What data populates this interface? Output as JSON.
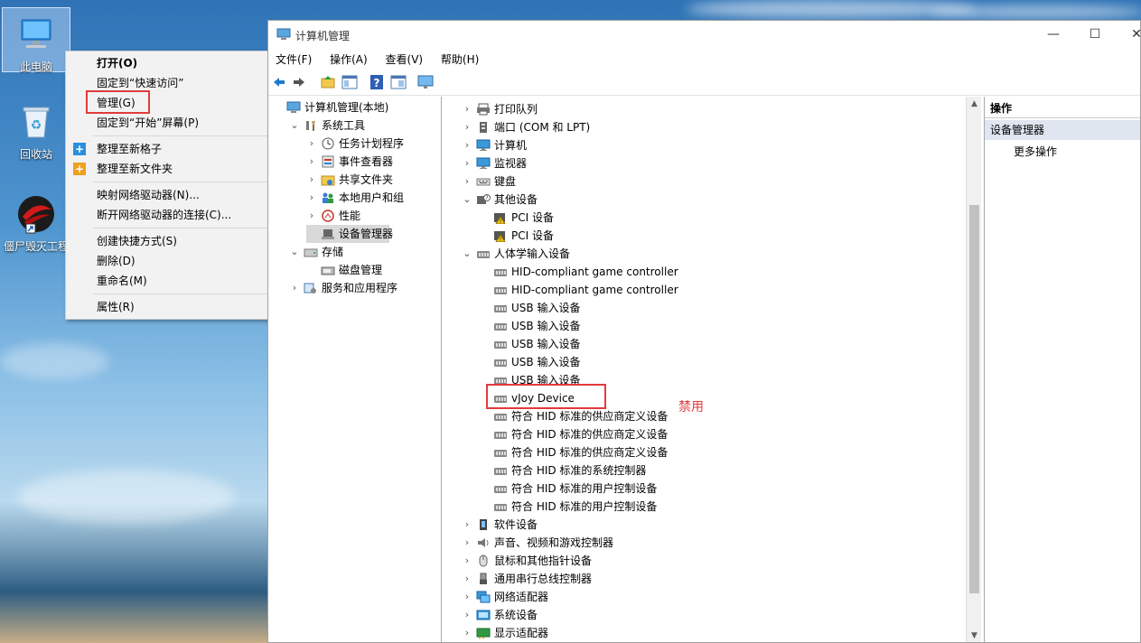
{
  "desktop": {
    "icons": [
      {
        "label": "此电脑"
      },
      {
        "label": "回收站"
      },
      {
        "label": "僵尸毁灭工程"
      }
    ]
  },
  "context_menu": {
    "items": [
      {
        "label": "打开(O)",
        "bold": true
      },
      {
        "label": "固定到“快速访问”"
      },
      {
        "label": "管理(G)",
        "highlighted": true
      },
      {
        "label": "固定到“开始”屏幕(P)"
      },
      {
        "separator": true
      },
      {
        "label": "整理至新格子",
        "icon": "plus-blue-icon"
      },
      {
        "label": "整理至新文件夹",
        "icon": "plus-orange-icon"
      },
      {
        "separator": true
      },
      {
        "label": "映射网络驱动器(N)..."
      },
      {
        "label": "断开网络驱动器的连接(C)..."
      },
      {
        "separator": true
      },
      {
        "label": "创建快捷方式(S)"
      },
      {
        "label": "删除(D)"
      },
      {
        "label": "重命名(M)"
      },
      {
        "separator": true
      },
      {
        "label": "属性(R)"
      }
    ]
  },
  "window": {
    "title": "计算机管理",
    "menus": [
      "文件(F)",
      "操作(A)",
      "查看(V)",
      "帮助(H)"
    ],
    "left_tree": [
      {
        "label": "计算机管理(本地)",
        "indent": 0,
        "exp": "",
        "icon": "computer-manage-icon"
      },
      {
        "label": "系统工具",
        "indent": 1,
        "exp": "v",
        "icon": "tools-icon"
      },
      {
        "label": "任务计划程序",
        "indent": 2,
        "exp": ">",
        "icon": "clock-icon"
      },
      {
        "label": "事件查看器",
        "indent": 2,
        "exp": ">",
        "icon": "event-viewer-icon"
      },
      {
        "label": "共享文件夹",
        "indent": 2,
        "exp": ">",
        "icon": "shared-folder-icon"
      },
      {
        "label": "本地用户和组",
        "indent": 2,
        "exp": ">",
        "icon": "users-icon"
      },
      {
        "label": "性能",
        "indent": 2,
        "exp": ">",
        "icon": "performance-icon"
      },
      {
        "label": "设备管理器",
        "indent": 2,
        "exp": "",
        "icon": "device-manager-icon",
        "selected": true
      },
      {
        "label": "存储",
        "indent": 1,
        "exp": "v",
        "icon": "storage-icon"
      },
      {
        "label": "磁盘管理",
        "indent": 2,
        "exp": "",
        "icon": "disk-icon"
      },
      {
        "label": "服务和应用程序",
        "indent": 1,
        "exp": ">",
        "icon": "services-icon"
      }
    ],
    "device_tree": [
      {
        "label": "打印队列",
        "indent": 0,
        "exp": ">",
        "icon": "printer-icon"
      },
      {
        "label": "端口 (COM 和 LPT)",
        "indent": 0,
        "exp": ">",
        "icon": "port-icon"
      },
      {
        "label": "计算机",
        "indent": 0,
        "exp": ">",
        "icon": "monitor-icon"
      },
      {
        "label": "监视器",
        "indent": 0,
        "exp": ">",
        "icon": "monitor-icon"
      },
      {
        "label": "键盘",
        "indent": 0,
        "exp": ">",
        "icon": "keyboard-icon"
      },
      {
        "label": "其他设备",
        "indent": 0,
        "exp": "v",
        "icon": "other-device-icon"
      },
      {
        "label": "PCI 设备",
        "indent": 1,
        "exp": "",
        "icon": "warning-device-icon"
      },
      {
        "label": "PCI 设备",
        "indent": 1,
        "exp": "",
        "icon": "warning-device-icon"
      },
      {
        "label": "人体学输入设备",
        "indent": 0,
        "exp": "v",
        "icon": "hid-icon"
      },
      {
        "label": "HID-compliant game controller",
        "indent": 1,
        "exp": "",
        "icon": "hid-icon"
      },
      {
        "label": "HID-compliant game controller",
        "indent": 1,
        "exp": "",
        "icon": "hid-icon"
      },
      {
        "label": "USB 输入设备",
        "indent": 1,
        "exp": "",
        "icon": "hid-icon"
      },
      {
        "label": "USB 输入设备",
        "indent": 1,
        "exp": "",
        "icon": "hid-icon"
      },
      {
        "label": "USB 输入设备",
        "indent": 1,
        "exp": "",
        "icon": "hid-icon"
      },
      {
        "label": "USB 输入设备",
        "indent": 1,
        "exp": "",
        "icon": "hid-icon"
      },
      {
        "label": "USB 输入设备",
        "indent": 1,
        "exp": "",
        "icon": "hid-icon"
      },
      {
        "label": "vJoy Device",
        "indent": 1,
        "exp": "",
        "icon": "hid-icon",
        "highlighted": true
      },
      {
        "label": "符合 HID 标准的供应商定义设备",
        "indent": 1,
        "exp": "",
        "icon": "hid-icon"
      },
      {
        "label": "符合 HID 标准的供应商定义设备",
        "indent": 1,
        "exp": "",
        "icon": "hid-icon"
      },
      {
        "label": "符合 HID 标准的供应商定义设备",
        "indent": 1,
        "exp": "",
        "icon": "hid-icon"
      },
      {
        "label": "符合 HID 标准的系统控制器",
        "indent": 1,
        "exp": "",
        "icon": "hid-icon"
      },
      {
        "label": "符合 HID 标准的用户控制设备",
        "indent": 1,
        "exp": "",
        "icon": "hid-icon"
      },
      {
        "label": "符合 HID 标准的用户控制设备",
        "indent": 1,
        "exp": "",
        "icon": "hid-icon"
      },
      {
        "label": "软件设备",
        "indent": 0,
        "exp": ">",
        "icon": "software-device-icon"
      },
      {
        "label": "声音、视频和游戏控制器",
        "indent": 0,
        "exp": ">",
        "icon": "speaker-icon"
      },
      {
        "label": "鼠标和其他指针设备",
        "indent": 0,
        "exp": ">",
        "icon": "mouse-icon"
      },
      {
        "label": "通用串行总线控制器",
        "indent": 0,
        "exp": ">",
        "icon": "usb-icon"
      },
      {
        "label": "网络适配器",
        "indent": 0,
        "exp": ">",
        "icon": "network-icon"
      },
      {
        "label": "系统设备",
        "indent": 0,
        "exp": ">",
        "icon": "system-device-icon"
      },
      {
        "label": "显示适配器",
        "indent": 0,
        "exp": ">",
        "icon": "display-adapter-icon"
      }
    ],
    "actions": {
      "header": "操作",
      "section": "设备管理器",
      "more": "更多操作"
    }
  },
  "annotation": {
    "disable_note": "禁用",
    "color": "#e23b3b"
  },
  "colors": {
    "selection": "#d9d9d9",
    "action_section": "#dfe6f0",
    "menu_bg": "#f2f2f2"
  }
}
